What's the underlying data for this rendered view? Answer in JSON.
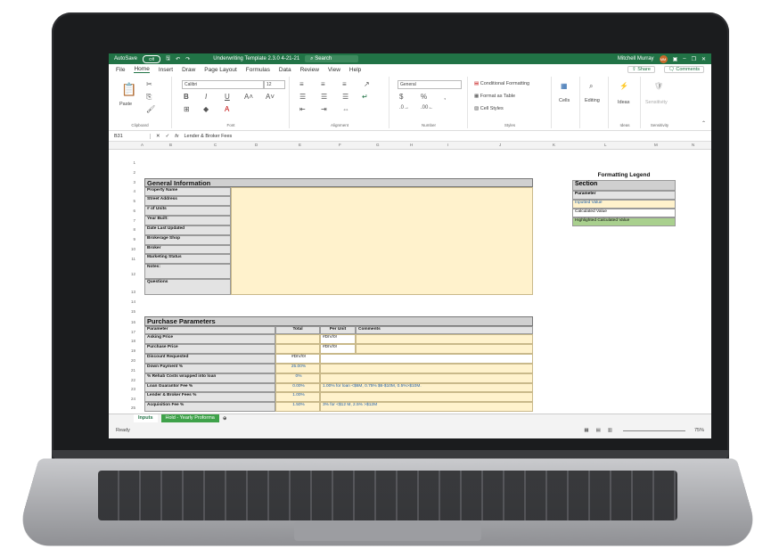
{
  "titlebar": {
    "autosave_label": "AutoSave",
    "autosave_state": "Off",
    "doc_title": "Underwriting Template 2.3.0 4-21-21",
    "search_placeholder": "Search",
    "user_name": "Mitchell Murray",
    "user_initials": "MM"
  },
  "menu": {
    "items": [
      "File",
      "Home",
      "Insert",
      "Draw",
      "Page Layout",
      "Formulas",
      "Data",
      "Review",
      "View",
      "Help"
    ],
    "share": "Share",
    "comments": "Comments"
  },
  "ribbon": {
    "paste": "Paste",
    "clipboard": "Clipboard",
    "font_name": "Calibri",
    "font_size": "12",
    "font_group": "Font",
    "alignment_group": "Alignment",
    "number_format": "General",
    "number_group": "Number",
    "conditional_formatting": "Conditional Formatting",
    "format_as_table": "Format as Table",
    "cell_styles": "Cell Styles",
    "styles_group": "Styles",
    "cells": "Cells",
    "editing": "Editing",
    "ideas": "Ideas",
    "ideas_group": "Ideas",
    "sensitivity": "Sensitivity",
    "sensitivity_group": "Sensitivity"
  },
  "formula_bar": {
    "cell_ref": "B31",
    "content": "Lender & Broker Fees"
  },
  "columns": [
    "A",
    "B",
    "C",
    "D",
    "E",
    "F",
    "G",
    "H",
    "I",
    "J",
    "K",
    "L",
    "M",
    "N"
  ],
  "rows": [
    "1",
    "2",
    "3",
    "4",
    "5",
    "6",
    "7",
    "8",
    "9",
    "10",
    "11",
    "12",
    "13",
    "14",
    "15",
    "16",
    "17",
    "18",
    "19",
    "20",
    "21",
    "22",
    "23",
    "24",
    "25"
  ],
  "general": {
    "title": "General Information",
    "fields": [
      "Property Name",
      "Street Address",
      "# of Units",
      "Year Built:",
      "Date Last Updated",
      "Brokerage Shop",
      "Broker",
      "Marketing Status",
      "Notes:",
      "Questions"
    ]
  },
  "purchase": {
    "title": "Purchase Parameters",
    "headers": {
      "parameter": "Parameter",
      "total": "Total",
      "per_unit": "Per Unit",
      "comments": "Comments"
    },
    "rows": [
      {
        "label": "Asking Price",
        "total": "",
        "per_unit": "#DIV/0!",
        "comment": ""
      },
      {
        "label": "Purchase Price",
        "total": "",
        "per_unit": "#DIV/0!",
        "comment": ""
      },
      {
        "label": "Discount Requested",
        "total": "#DIV/0!",
        "per_unit": "",
        "comment": ""
      },
      {
        "label": "Down Payment %",
        "total": "25.00%",
        "per_unit": "",
        "comment": ""
      },
      {
        "label": "% Rehab Costs wrapped into loan",
        "total": "0%",
        "per_unit": "",
        "comment": ""
      },
      {
        "label": "Loan Guarantor Fee %",
        "total": "0.00%",
        "per_unit": "",
        "comment": "1.00% for loan <$6M, 0.75% $6-$10M, 0.5%>$10M."
      },
      {
        "label": "Lender & Broker Fees %",
        "total": "1.00%",
        "per_unit": "",
        "comment": ""
      },
      {
        "label": "Acquisition Fee %",
        "total": "1.50%",
        "per_unit": "",
        "comment": "3% for <$12 M, 2.5% >$12M"
      }
    ]
  },
  "legend": {
    "title": "Formatting Legend",
    "section": "Section",
    "parameter": "Parameter",
    "inputted": "Inputted Value",
    "calculated": "Calculated Value",
    "highlighted": "Highlighted Calculated  Value"
  },
  "sheets": [
    "Inputs",
    "Hold - Yearly Proforma"
  ],
  "status": {
    "ready": "Ready",
    "zoom": "75%"
  }
}
